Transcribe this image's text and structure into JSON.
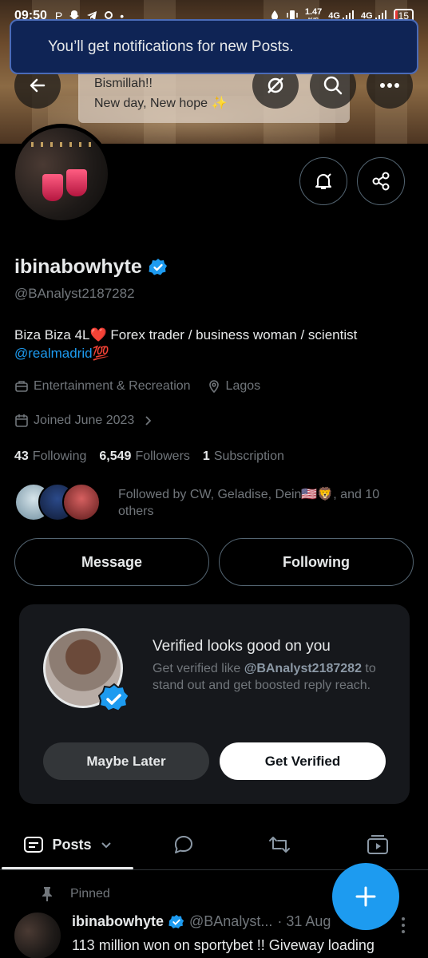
{
  "status_bar": {
    "time": "09:50",
    "data_speed": "1.47",
    "data_unit": "K/S",
    "network_1": "4G",
    "network_2": "4G",
    "battery": "15",
    "battery_level": 0.15
  },
  "toast": {
    "message": "You’ll get notifications for new Posts."
  },
  "banner": {
    "line1": "Bismillah!!",
    "line2": "New day, New hope ✨"
  },
  "profile": {
    "name": "ibinabowhyte",
    "handle": "@BAnalyst2187282",
    "bio_text": "Biza Biza 4L❤️ Forex trader / business woman / scientist",
    "bio_link": "@realmadrid💯",
    "category": "Entertainment & Recreation",
    "location": "Lagos",
    "joined": "Joined June 2023",
    "following_count": "43",
    "following_label": "Following",
    "followers_count": "6,549",
    "followers_label": "Followers",
    "subscription_count": "1",
    "subscription_label": "Subscription",
    "followed_by": "Followed by CW, Geladise, Dein🇺🇸🦁, and 10 others"
  },
  "actions": {
    "message": "Message",
    "following": "Following"
  },
  "verified_card": {
    "title": "Verified looks good on you",
    "desc_prefix": "Get verified like ",
    "desc_handle": "@BAnalyst2187282",
    "desc_suffix": " to stand out and get boosted reply reach.",
    "maybe_later": "Maybe Later",
    "get_verified": "Get Verified"
  },
  "tabs": {
    "posts": "Posts"
  },
  "post": {
    "pinned": "Pinned",
    "name": "ibinabowhyte",
    "handle": "@BAnalyst...",
    "time": "· 31 Aug",
    "text": "113 million won on sportybet !! Giveway loading"
  },
  "colors": {
    "accent": "#1d9bf0",
    "background": "#000000",
    "muted": "#71767b",
    "toast_bg": "#0f2455"
  }
}
